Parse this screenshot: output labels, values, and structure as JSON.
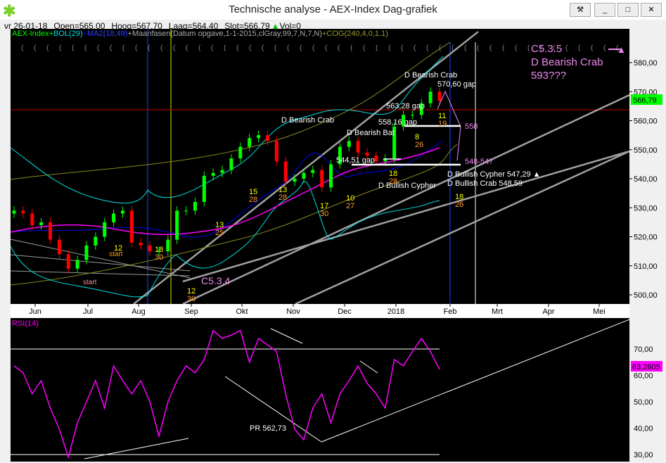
{
  "window": {
    "title": "Technische analyse -   AEX-Index Dag-grafiek",
    "buttons": [
      "⚒",
      "_",
      "□",
      "✕"
    ]
  },
  "info": {
    "date": "vr 26-01-18",
    "open": "Open=565,00",
    "high": "Hoog=567,70",
    "low": "Laag=564,40",
    "close": "Slot=566,79",
    "vol": "Vol=0"
  },
  "legend": {
    "aex": "AEX-Index",
    "plus1": "+",
    "bol": "BOL(29)",
    "plus2": "+",
    "ma": "MA2(18,49)",
    "moon": "+Maanfasen(Datum opgave,1-1-2015,clGray,99,7,N,7,N)",
    "cog": "+COG(240,4,0,1.1)"
  },
  "colors": {
    "up": "#00ff00",
    "down": "#ff0000",
    "bol": "#00e0e0",
    "ma_fast": "#0000ff",
    "ma_slow": "#ff00ff",
    "rsi": "#ff00ff",
    "annot": "#ee88ee"
  },
  "annotations": {
    "bearish_crab_top": "D Bearish Crab",
    "gap570": "570,60 gap",
    "gap563": "563,28 gap",
    "gap558": "558,16 gap",
    "bearish_bat": "D Bearish Bat",
    "bearish_crab_nov": "D Bearish Crab",
    "gap544": "544,51 gap",
    "bullish_cypher": "D Bullish Cypher",
    "cypher_target": "D Bullish Cypher 547,29 ▲",
    "crab_target": "D Bullish Crab 548,59",
    "lvl558": "558",
    "lvl548": "548-547",
    "c535": "C5.3.5",
    "crab593a": "D Bearish Crab",
    "crab593b": "593???",
    "c534": "C5.3.4",
    "start1": "start",
    "start2": "start",
    "pr": "PR 562,73",
    "counts": [
      [
        "12",
        "30"
      ],
      [
        "18",
        "30"
      ],
      [
        "12",
        ""
      ],
      [
        "13",
        "25"
      ],
      [
        "15",
        "28"
      ],
      [
        "13",
        "28"
      ],
      [
        "17",
        "30"
      ],
      [
        "10",
        "27"
      ],
      [
        "18",
        "28"
      ],
      [
        "8",
        "26"
      ],
      [
        "11",
        "19"
      ],
      [
        "18",
        "26"
      ]
    ]
  },
  "chart_data": [
    {
      "type": "line",
      "title": "AEX-Index Dag-grafiek (candlestick)",
      "ylim": [
        497,
        590
      ],
      "yticks": [
        "500,00",
        "510,00",
        "520,00",
        "530,00",
        "540,00",
        "550,00",
        "560,00",
        "570,00",
        "580,00"
      ],
      "last_value": "566,79",
      "xticks": [
        "Jun",
        "Jul",
        "Aug",
        "Sep",
        "Okt",
        "Nov",
        "Dec",
        "2018",
        "Feb",
        "Mrt",
        "Apr",
        "Mei"
      ],
      "closes": [
        529,
        528,
        524,
        525,
        519,
        514,
        509,
        512,
        517,
        520,
        525,
        528,
        529,
        518,
        517,
        515,
        515,
        519,
        529,
        529,
        532,
        541,
        542,
        543,
        547,
        551,
        554,
        555,
        553,
        546,
        539,
        540,
        542,
        543,
        537,
        545,
        551,
        553,
        549,
        548,
        546,
        547,
        558,
        562,
        562,
        566,
        570,
        566.79
      ]
    },
    {
      "type": "line",
      "title": "RSI(14)",
      "ylim": [
        28,
        82
      ],
      "yticks": [
        "30,00",
        "40,00",
        "50,00",
        "60,00",
        "70,00"
      ],
      "last_value": "63,2605",
      "values": [
        63.6,
        61,
        53,
        58,
        47.6,
        39.6,
        29,
        42,
        50,
        58,
        47.6,
        63.6,
        58,
        53,
        58,
        50,
        37,
        50,
        58,
        63.6,
        61,
        66,
        77,
        74,
        75.3,
        77,
        65,
        74,
        71.6,
        69,
        53,
        39.6,
        35.6,
        47.6,
        53,
        42,
        53,
        58,
        63.6,
        57,
        53,
        47.6,
        66,
        63.6,
        69,
        74,
        69,
        62.3
      ]
    }
  ]
}
